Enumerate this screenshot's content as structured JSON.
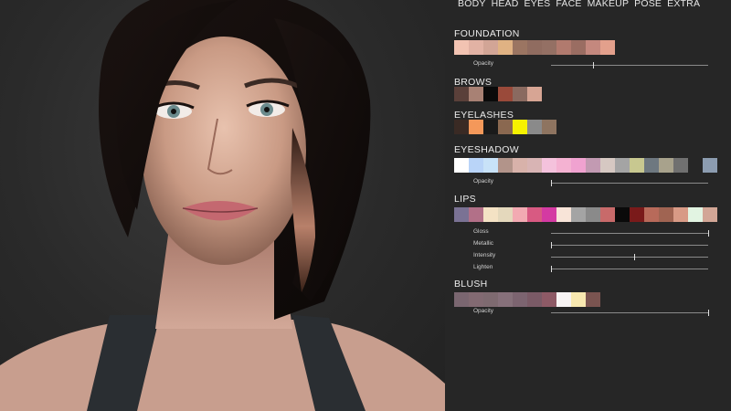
{
  "nav": {
    "tabs": [
      "BODY",
      "HEAD",
      "EYES",
      "FACE",
      "MAKEUP",
      "POSE",
      "EXTRA"
    ]
  },
  "sections": {
    "foundation": {
      "title": "FOUNDATION",
      "colors": [
        "#f2c3b2",
        "#e2b2a4",
        "#d2a596",
        "#e0b283",
        "#9b7562",
        "#906c60",
        "#947064",
        "#b17a6e",
        "#9a6d62",
        "#c4887e",
        "#e3a08c"
      ],
      "sliders": [
        {
          "label": "Opacity",
          "value": 0.27
        }
      ]
    },
    "brows": {
      "title": "BROWS",
      "colors": [
        "#5a403a",
        "#a88174",
        "#0a0a0a",
        "#9a4a3a",
        "#8a6a60",
        "#d7a594"
      ]
    },
    "eyelashes": {
      "title": "EYELASHES",
      "colors": [
        "#3a2a24",
        "#f4985a",
        "#1a1a1a",
        "#8a6850",
        "#f6f200",
        "#8a8a8a",
        "#8e7460"
      ]
    },
    "eyeshadow": {
      "title": "EYESHADOW",
      "colors": [
        "#ffffff",
        "#b9d4f8",
        "#c8e2f8",
        "#b2948a",
        "#d8b2aa",
        "#d8b4b4",
        "#f4c2dc",
        "#f4b2d2",
        "#f0a2d0",
        "#c29ab2",
        "#d6c8c2",
        "#a4a4a4",
        "#c8c890",
        "#6e7880",
        "#a8a28c",
        "#707070",
        "gap",
        "#8c9cb0"
      ],
      "sliders": [
        {
          "label": "Opacity",
          "value": 0.0
        }
      ]
    },
    "lips": {
      "title": "LIPS",
      "colors": [
        "#7a7294",
        "#b27088",
        "#f4e2c4",
        "#e4d8bc",
        "#f2aab2",
        "#d85a82",
        "#d43aa2",
        "#f8e4d8",
        "#a4a4a4",
        "#8a8a8a",
        "#c86a6a",
        "#0a0a0a",
        "#7a1a1a",
        "#b86a5a",
        "#a06452",
        "#d89a86",
        "#e2f4e2",
        "#d2a696"
      ],
      "sliders": [
        {
          "label": "Gloss",
          "value": 1.0
        },
        {
          "label": "Metallic",
          "value": 0.0
        },
        {
          "label": "Intensity",
          "value": 0.53
        },
        {
          "label": "Lighten",
          "value": 0.0
        }
      ]
    },
    "blush": {
      "title": "BLUSH",
      "colors": [
        "#7a6670",
        "#826a72",
        "#7e6a70",
        "#86707a",
        "#7c6470",
        "#7a5a66",
        "#8e5a66",
        "#f8f4f4",
        "#f8e8b0",
        "#7a5450"
      ],
      "sliders": [
        {
          "label": "Opacity",
          "value": 1.0
        }
      ]
    }
  }
}
